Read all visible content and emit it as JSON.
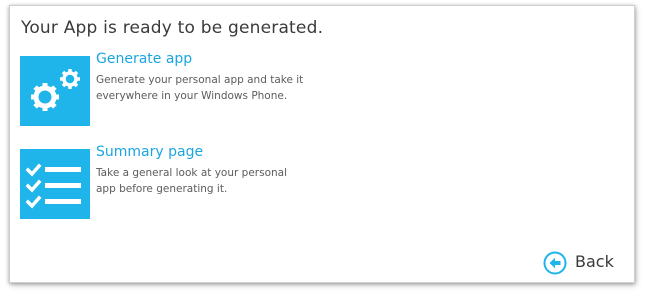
{
  "dialog": {
    "title": "Your App is ready to be generated."
  },
  "options": [
    {
      "title": "Generate app",
      "description_lines": [
        "Generate your personal app and take it",
        "everywhere in your Windows Phone."
      ],
      "icon": "gears-icon"
    },
    {
      "title": "Summary page",
      "description_lines": [
        "Take a general look at your personal",
        "app before generating it."
      ],
      "icon": "checklist-icon"
    }
  ],
  "back": {
    "label": "Back",
    "icon": "back-arrow-circle-icon"
  },
  "colors": {
    "tile": "#1fb4ea",
    "accent_text": "#1ba6e0",
    "title_text": "#3a3a3a",
    "body_text": "#5c5c5c"
  }
}
